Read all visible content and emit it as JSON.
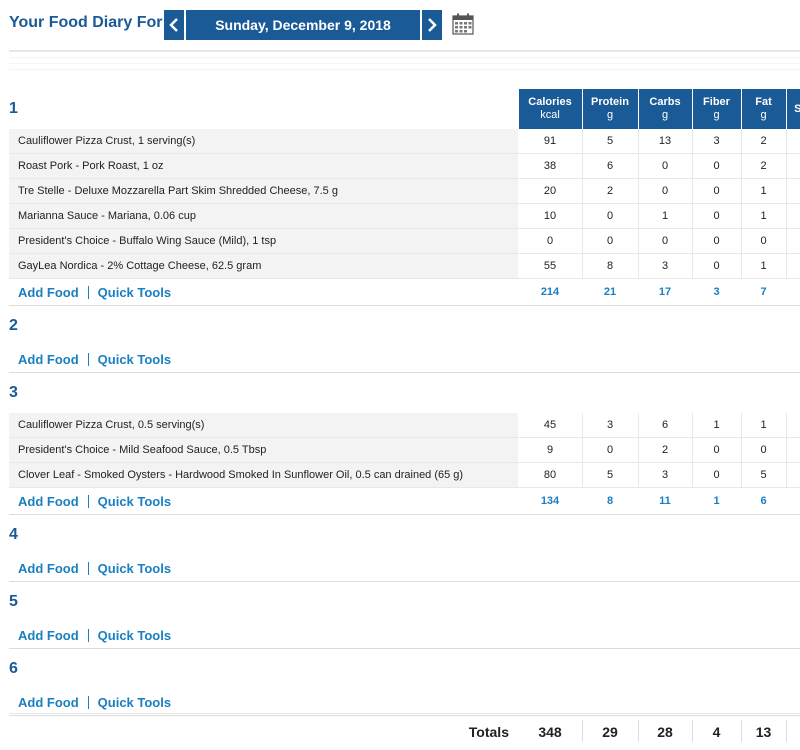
{
  "header": {
    "title": "Your Food Diary For:",
    "date": "Sunday, December 9, 2018",
    "prev_icon": "chevron-left-icon",
    "next_icon": "chevron-right-icon",
    "calendar_icon": "calendar-icon"
  },
  "columns": [
    {
      "label": "Calories",
      "unit": "kcal"
    },
    {
      "label": "Protein",
      "unit": "g"
    },
    {
      "label": "Carbs",
      "unit": "g"
    },
    {
      "label": "Fiber",
      "unit": "g"
    },
    {
      "label": "Fat",
      "unit": "g"
    },
    {
      "label": "S",
      "unit": ""
    }
  ],
  "actions": {
    "add_food": "Add Food",
    "quick_tools": "Quick Tools"
  },
  "meals": [
    {
      "name": "1",
      "foods": [
        {
          "name": "Cauliflower Pizza Crust, 1 serving(s)",
          "cal": "91",
          "protein": "5",
          "carbs": "13",
          "fiber": "3",
          "fat": "2"
        },
        {
          "name": "Roast Pork - Pork Roast, 1 oz",
          "cal": "38",
          "protein": "6",
          "carbs": "0",
          "fiber": "0",
          "fat": "2"
        },
        {
          "name": "Tre Stelle - Deluxe Mozzarella Part Skim Shredded Cheese, 7.5 g",
          "cal": "20",
          "protein": "2",
          "carbs": "0",
          "fiber": "0",
          "fat": "1"
        },
        {
          "name": "Marianna Sauce - Mariana, 0.06 cup",
          "cal": "10",
          "protein": "0",
          "carbs": "1",
          "fiber": "0",
          "fat": "1"
        },
        {
          "name": "President's Choice - Buffalo Wing Sauce (Mild), 1 tsp",
          "cal": "0",
          "protein": "0",
          "carbs": "0",
          "fiber": "0",
          "fat": "0"
        },
        {
          "name": "GayLea Nordica - 2% Cottage Cheese, 62.5 gram",
          "cal": "55",
          "protein": "8",
          "carbs": "3",
          "fiber": "0",
          "fat": "1"
        }
      ],
      "totals": {
        "cal": "214",
        "protein": "21",
        "carbs": "17",
        "fiber": "3",
        "fat": "7"
      }
    },
    {
      "name": "2",
      "foods": [],
      "totals": null
    },
    {
      "name": "3",
      "foods": [
        {
          "name": "Cauliflower Pizza Crust, 0.5 serving(s)",
          "cal": "45",
          "protein": "3",
          "carbs": "6",
          "fiber": "1",
          "fat": "1"
        },
        {
          "name": "President's Choice - Mild Seafood Sauce, 0.5 Tbsp",
          "cal": "9",
          "protein": "0",
          "carbs": "2",
          "fiber": "0",
          "fat": "0"
        },
        {
          "name": "Clover Leaf - Smoked Oysters - Hardwood Smoked In Sunflower Oil, 0.5 can drained (65 g)",
          "cal": "80",
          "protein": "5",
          "carbs": "3",
          "fiber": "0",
          "fat": "5"
        }
      ],
      "totals": {
        "cal": "134",
        "protein": "8",
        "carbs": "11",
        "fiber": "1",
        "fat": "6"
      }
    },
    {
      "name": "4",
      "foods": [],
      "totals": null
    },
    {
      "name": "5",
      "foods": [],
      "totals": null
    },
    {
      "name": "6",
      "foods": [],
      "totals": null
    }
  ],
  "totals": {
    "label": "Totals",
    "cal": "348",
    "protein": "29",
    "carbs": "28",
    "fiber": "4",
    "fat": "13"
  },
  "colors": {
    "brand": "#1a5a96",
    "link": "#1a7fc1"
  }
}
